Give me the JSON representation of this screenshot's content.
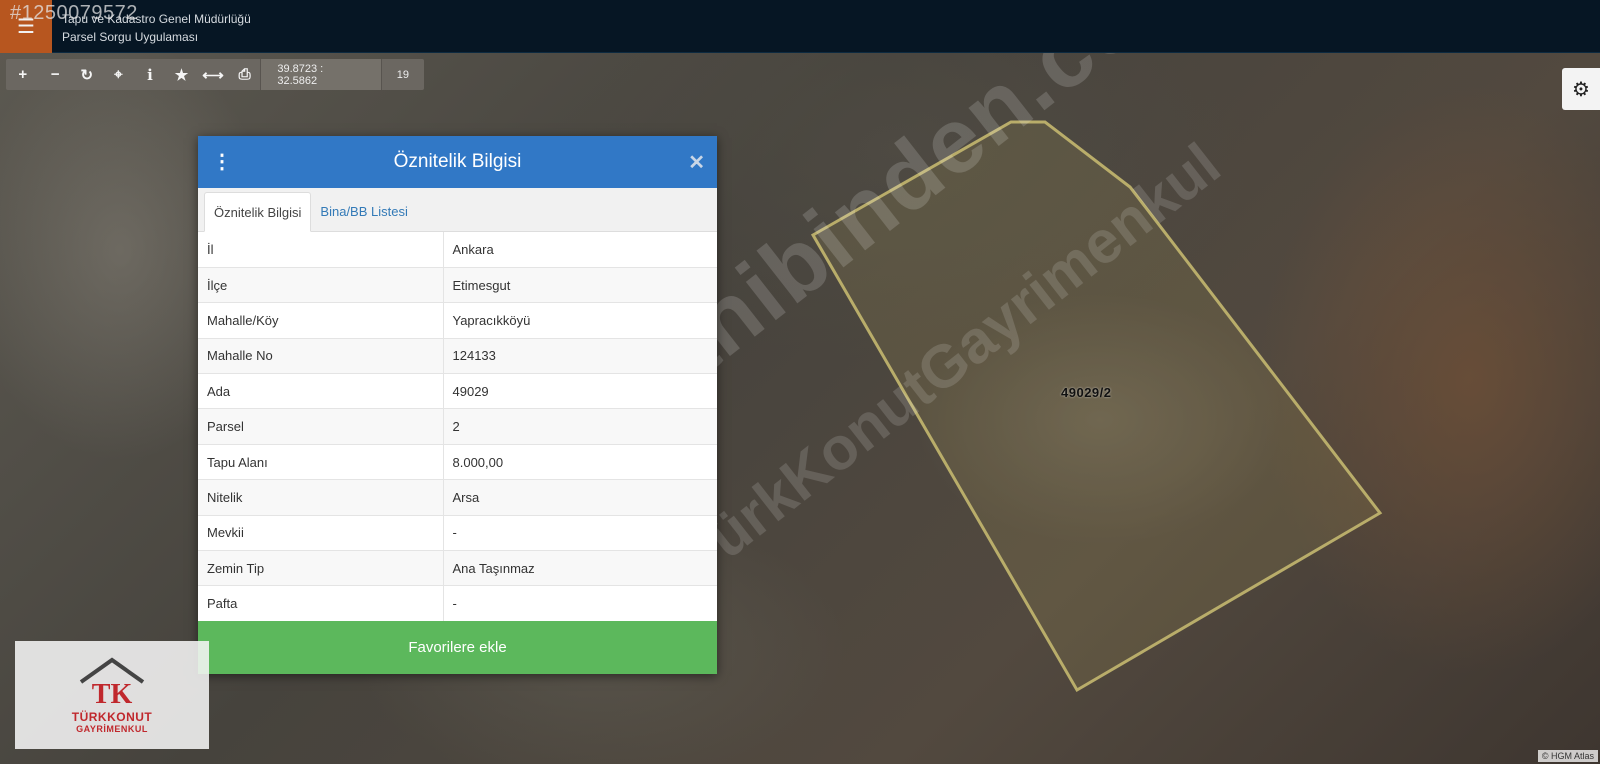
{
  "listing_id": "#1250079572",
  "header": {
    "title_line1": "Tapu ve Kadastro Genel Müdürlüğü",
    "title_line2": "Parsel Sorgu Uygulaması",
    "menu_icon": "hamburger-icon",
    "accent_color": "#b7561f"
  },
  "toolbar": {
    "coordinates": "39.8723 : 32.5862",
    "zoom": "19",
    "buttons": [
      {
        "icon": "zoom-in-icon",
        "glyph": "+"
      },
      {
        "icon": "zoom-out-icon",
        "glyph": "−"
      },
      {
        "icon": "refresh-icon",
        "glyph": "↻"
      },
      {
        "icon": "locate-icon",
        "glyph": "⌖"
      },
      {
        "icon": "info-icon",
        "glyph": "i"
      },
      {
        "icon": "star-icon",
        "glyph": "★"
      },
      {
        "icon": "measure-icon",
        "glyph": "⟷"
      },
      {
        "icon": "print-icon",
        "glyph": "⎙"
      }
    ]
  },
  "settings_icon": "gear-icon",
  "map": {
    "parcel_label": "49029/2",
    "watermark1": "sahibinden.com",
    "watermark2": "TürkKonutGayrimenkul",
    "parcel_outline_color": "#b9ad6a"
  },
  "dialog": {
    "title": "Öznitelik Bilgisi",
    "header_color": "#3178c6",
    "tabs": [
      "Öznitelik Bilgisi",
      "Bina/BB Listesi"
    ],
    "rows": [
      {
        "label": "İl",
        "value": "Ankara"
      },
      {
        "label": "İlçe",
        "value": "Etimesgut"
      },
      {
        "label": "Mahalle/Köy",
        "value": "Yapracıkköyü"
      },
      {
        "label": "Mahalle No",
        "value": "124133"
      },
      {
        "label": "Ada",
        "value": "49029"
      },
      {
        "label": "Parsel",
        "value": "2"
      },
      {
        "label": "Tapu Alanı",
        "value": "8.000,00"
      },
      {
        "label": "Nitelik",
        "value": "Arsa"
      },
      {
        "label": "Mevkii",
        "value": "-"
      },
      {
        "label": "Zemin Tip",
        "value": "Ana Taşınmaz"
      },
      {
        "label": "Pafta",
        "value": "-"
      }
    ],
    "favorite_button": "Favorilere ekle",
    "favorite_color": "#5cb85c"
  },
  "logo": {
    "monogram": "TK",
    "brand": "TÜRKKONUT",
    "sub": "GAYRİMENKUL"
  },
  "attribution": "© HGM Atlas"
}
